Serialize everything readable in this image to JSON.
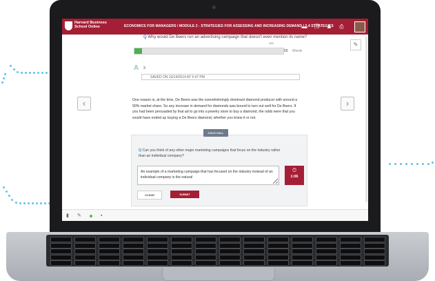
{
  "header": {
    "logo_text": "Harvard Business School Online",
    "breadcrumb": "ECONOMICS FOR MANAGERS / MODULE 2 - STRATEGIES FOR ASSESSING AND INCREASING DEMAND / 2.4 STRATEGIES"
  },
  "question1": {
    "text": "Why would De Beers run an advertising campaign that doesn't even mention its name?"
  },
  "word_slider": {
    "min_label": "1",
    "max_label": "100",
    "value": "55",
    "unit": "Words",
    "fill_fraction": 0.05
  },
  "answer_grade": {
    "letter": "A",
    "count": "3"
  },
  "saved_text": "SAVED ON 10/14/2014 AT 5:47 PM",
  "paragraph": "One reason is, at the time, De Beers was the overwhelmingly dominant diamond producer with around a 90% market share. So any increase in demand for diamonds was bound to turn out well for De Beers. If you had been persuaded by that ad to go into a jewelry store to buy a diamond, the odds were that you would have ended up buying a De Beers diamond, whether you knew it or not.",
  "nav": {
    "prev": "‹",
    "next": "›"
  },
  "cold_call": {
    "label": "COLD CALL",
    "question": "Can you think of any other major marketing campaigns that focus on the industry rather than an individual company?",
    "answer_value": "An example of a marketing campaign that has focused on the industry instead of an individual company is the natural",
    "timer_value": "1:06",
    "clear_label": "CLEAR",
    "submit_label": "SUBMIT"
  },
  "colors": {
    "brand": "#a41f35",
    "accent_blue": "#3a8fc9",
    "slider_green": "#4caf50"
  }
}
